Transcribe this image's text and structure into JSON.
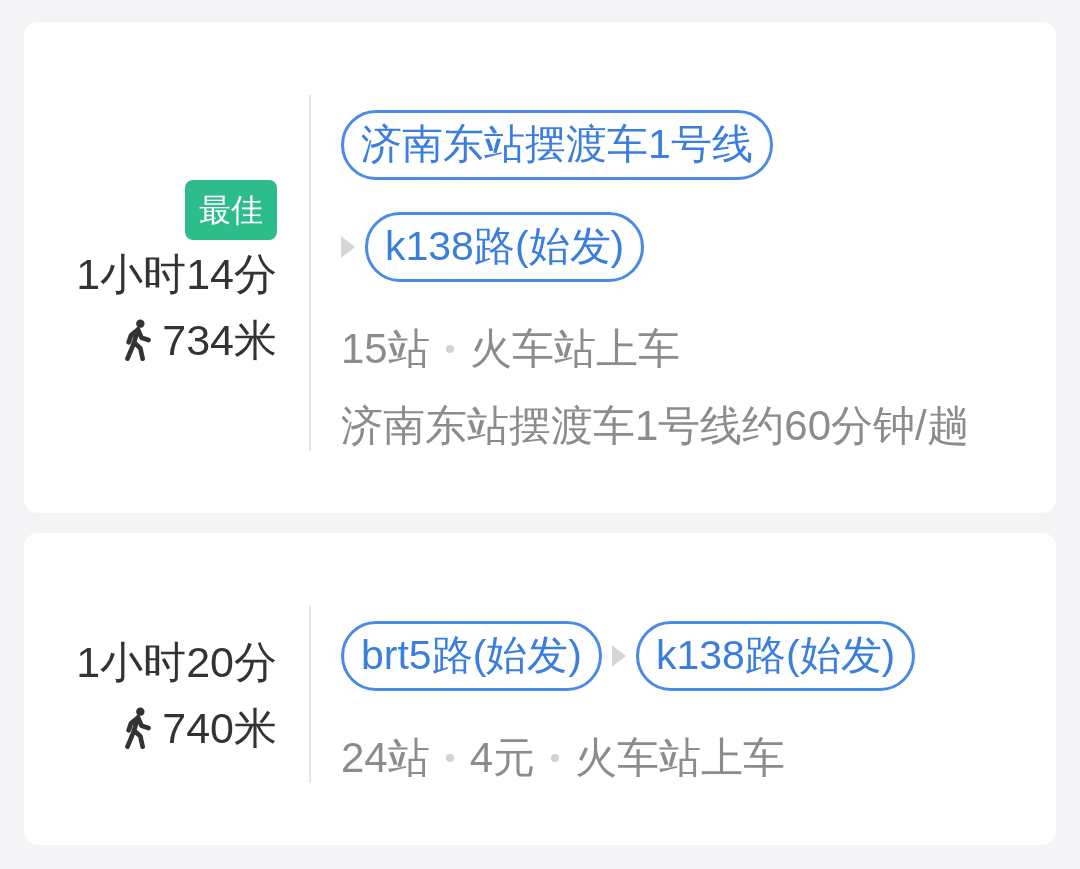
{
  "routes": [
    {
      "badge": "最佳",
      "duration": "1小时14分",
      "walk": "734米",
      "lines": [
        {
          "label": "济南东站摆渡车1号线"
        },
        {
          "label": "k138路(始发)"
        }
      ],
      "meta": [
        "15站",
        "火车站上车"
      ],
      "note": "济南东站摆渡车1号线约60分钟/趟"
    },
    {
      "duration": "1小时20分",
      "walk": "740米",
      "lines": [
        {
          "label": "brt5路(始发)"
        },
        {
          "label": "k138路(始发)"
        }
      ],
      "meta": [
        "24站",
        "4元",
        "火车站上车"
      ]
    }
  ]
}
